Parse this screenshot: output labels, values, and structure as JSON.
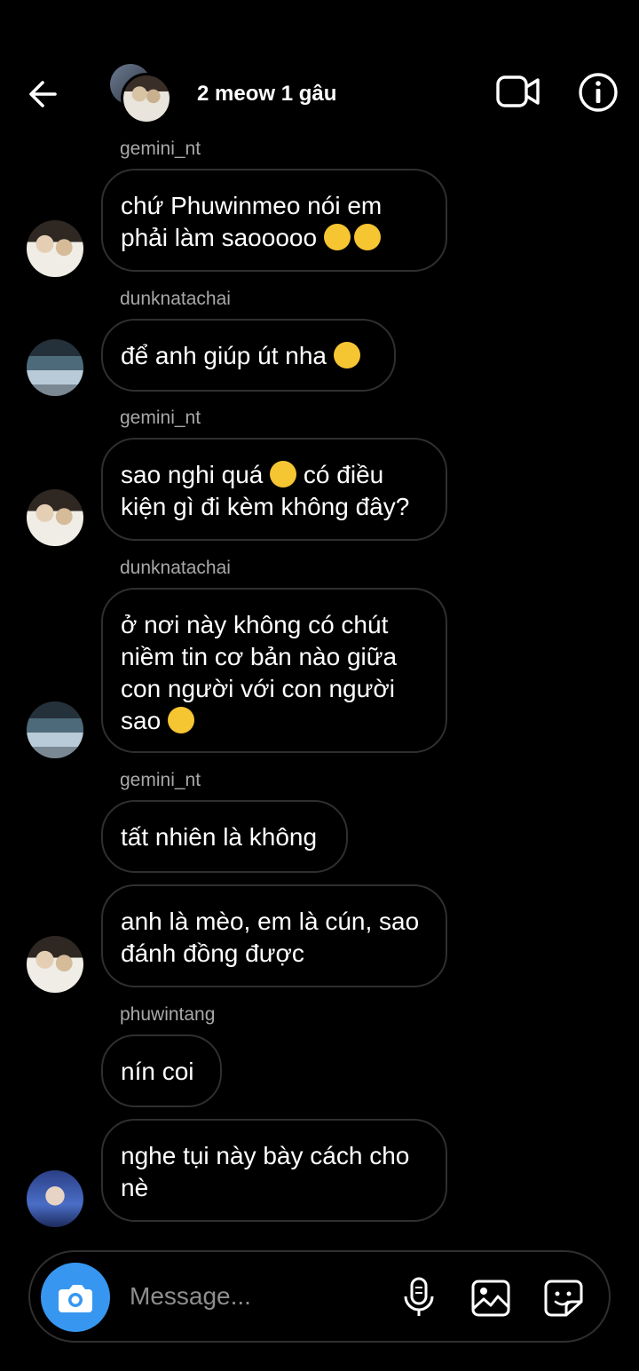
{
  "header": {
    "title": "2 meow 1 gâu"
  },
  "messages": [
    {
      "sender": "gemini_nt",
      "text": "chứ Phuwinmeo nói em\nphải làm saooooo ",
      "emoji": [
        "crying-face",
        "crying-face"
      ],
      "avatar": "gemini"
    },
    {
      "sender": "dunknatachai",
      "text": "để anh giúp út nha ",
      "emoji": [
        "smiling-face-with-hearts"
      ],
      "avatar": "dunk"
    },
    {
      "sender": "gemini_nt",
      "text_a": "sao nghi quá ",
      "text_b": " có điều\nkiện gì đi kèm không đây?",
      "emoji": [
        "face-with-monocle"
      ],
      "avatar": "gemini"
    },
    {
      "sender": "dunknatachai",
      "text": "ở nơi này không có chút\nniềm tin cơ bản nào giữa\ncon người với con người\nsao ",
      "emoji": [
        "disappointed-face"
      ],
      "avatar": "dunk"
    },
    {
      "sender": "gemini_nt",
      "text": "tất nhiên là không"
    },
    {
      "text": "anh là mèo, em là cún, sao\nđánh đồng được",
      "avatar": "gemini"
    },
    {
      "sender": "phuwintang",
      "text": "nín coi"
    },
    {
      "text": "nghe tụi này bày cách cho\nnè",
      "avatar": "phuwin"
    }
  ],
  "composer": {
    "placeholder": "Message..."
  },
  "colors": {
    "background": "#000000",
    "bubble_border": "#2f2f2f",
    "sender_text": "#a8a8a8",
    "camera_button": "#3797f0",
    "placeholder": "#8e8e8e"
  },
  "icons": [
    "back-arrow-icon",
    "video-call-icon",
    "info-icon",
    "camera-icon",
    "microphone-icon",
    "gallery-icon",
    "sticker-icon"
  ]
}
